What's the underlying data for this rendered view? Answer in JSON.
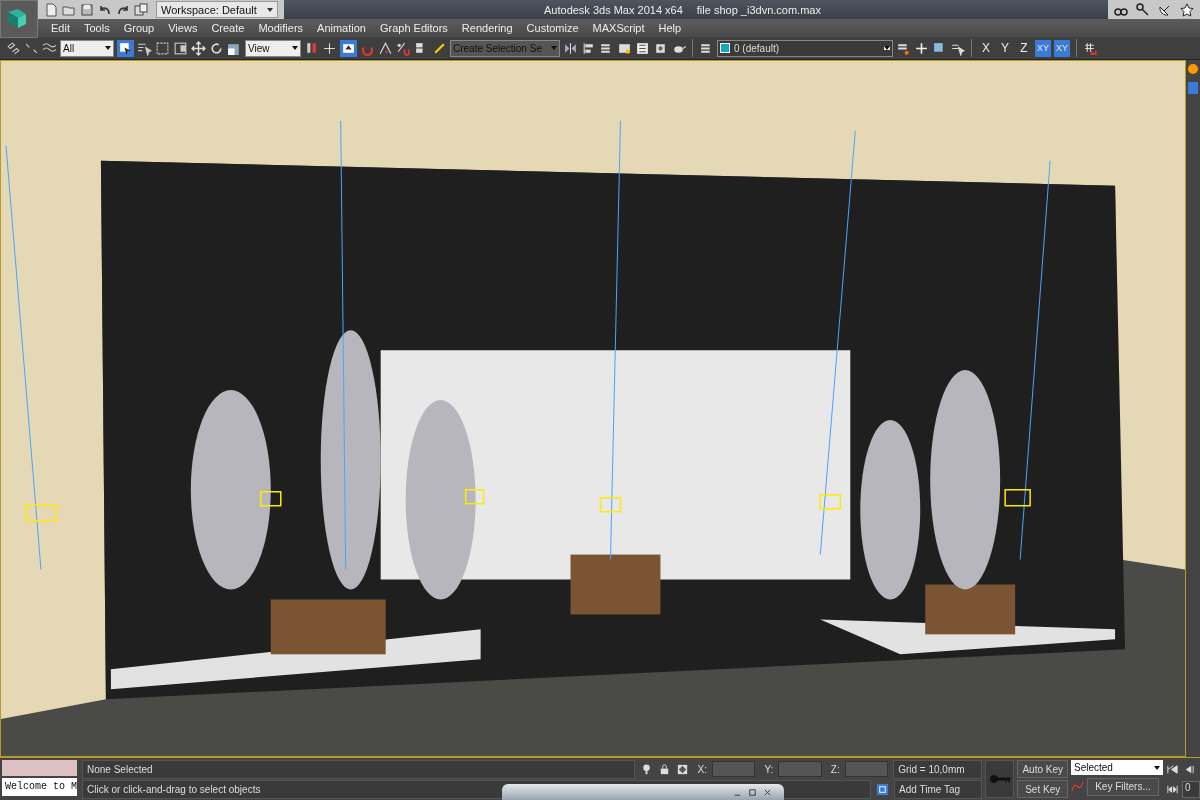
{
  "title_bar": {
    "workspace": "Workspace: Default",
    "title": "Autodesk 3ds Max  2014 x64",
    "file": "file shop _i3dvn.com.max"
  },
  "menu": [
    "Edit",
    "Tools",
    "Group",
    "Views",
    "Create",
    "Modifiers",
    "Animation",
    "Graph Editors",
    "Rendering",
    "Customize",
    "MAXScript",
    "Help"
  ],
  "toolbar": {
    "selection_filter": "All",
    "reference_coordinate": "View",
    "named_selection": "Create Selection Se",
    "layer": "0 (default)",
    "axes": [
      {
        "label": "X",
        "selected": false
      },
      {
        "label": "Y",
        "selected": false
      },
      {
        "label": "Z",
        "selected": false
      },
      {
        "label": "XY",
        "selected": true
      },
      {
        "label": "XY",
        "selected": true
      }
    ]
  },
  "status_bar": {
    "maxscript_output": "Welcome to M",
    "selection_status": "None Selected",
    "prompt": "Click or click-and-drag to select objects",
    "coords": [
      "X:",
      "Y:",
      "Z:"
    ],
    "grid": "Grid = 10,0mm",
    "time_tag": "Add Time Tag",
    "auto_key": "Auto Key",
    "set_key": "Set Key",
    "key_mode": "Selected",
    "key_filters": "Key Filters...",
    "frame": "0"
  }
}
